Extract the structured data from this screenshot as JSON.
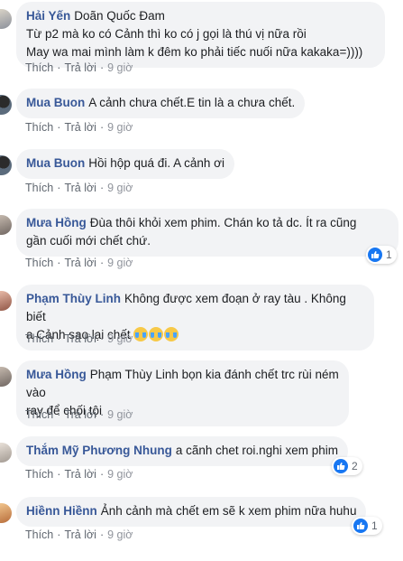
{
  "actions": {
    "like": "Thích",
    "reply": "Trả lời",
    "separator": "·"
  },
  "comments": [
    {
      "author": "Hải Yến",
      "mention": "Doãn Quốc Đam",
      "lines": [
        "Từ p2 mà ko có Cảnh thì ko có j gọi là thú vị nữa rồi",
        "May wa mai mình làm k đêm ko phải tiếc nuối nữa kakaka=))))"
      ],
      "time": "9 giờ",
      "reactions": null
    },
    {
      "author": "Mua Buon",
      "lines": [
        "A cảnh chưa chết.E tin là a chưa chết."
      ],
      "time": "9 giờ",
      "reactions": null
    },
    {
      "author": "Mua Buon",
      "lines": [
        "Hồi hộp quá đi. A cảnh ơi"
      ],
      "time": "9 giờ",
      "reactions": null
    },
    {
      "author": "Mưa Hồng",
      "lines": [
        "Đùa thôi khỏi xem phim. Chán ko tả dc. Ít ra cũng",
        "gần cuối mới chết chứ."
      ],
      "time": "9 giờ",
      "reactions": "1"
    },
    {
      "author": "Phạm Thùy Linh",
      "lines": [
        "Không được xem đoạn ở ray tàu . Không biết",
        "a Cảnh sao lại chết"
      ],
      "emoji": "crying-face",
      "emoji_count": 3,
      "time": "9 giờ",
      "reactions": null
    },
    {
      "author": "Mưa Hồng",
      "mention": "Phạm Thùy Linh",
      "lines": [
        "bọn kia đánh chết trc rùi ném vào",
        "ray để chối tội"
      ],
      "time": "9 giờ",
      "reactions": null
    },
    {
      "author": "Thắm Mỹ Phương Nhung",
      "lines": [
        "a cãnh chet roi.nghi xem phim"
      ],
      "time": "9 giờ",
      "reactions": "2"
    },
    {
      "author": "Hiềnn Hiềnn",
      "lines": [
        "Ảnh cảnh mà chết em sẽ k xem phim nữa huhu"
      ],
      "time": "9 giờ",
      "reactions": "1"
    }
  ]
}
